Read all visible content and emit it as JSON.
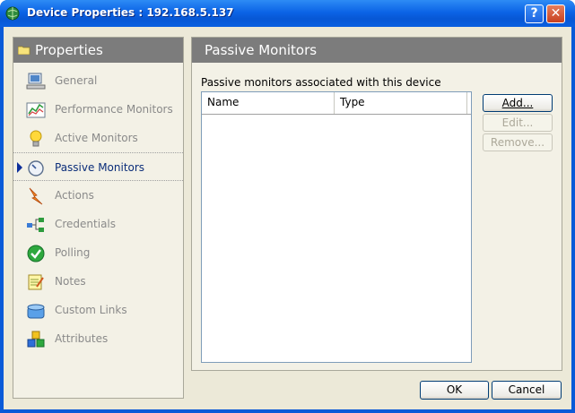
{
  "window": {
    "title": "Device Properties : 192.168.5.137",
    "help_label": "?",
    "close_label": "✕"
  },
  "sidebar": {
    "title": "Properties",
    "items": [
      {
        "label": "General",
        "icon": "computer-icon",
        "selected": false
      },
      {
        "label": "Performance Monitors",
        "icon": "performance-chart-icon",
        "selected": false
      },
      {
        "label": "Active Monitors",
        "icon": "lightbulb-icon",
        "selected": false
      },
      {
        "label": "Passive Monitors",
        "icon": "gauge-icon",
        "selected": true
      },
      {
        "label": "Actions",
        "icon": "lightning-icon",
        "selected": false
      },
      {
        "label": "Credentials",
        "icon": "network-icon",
        "selected": false
      },
      {
        "label": "Polling",
        "icon": "checkmark-icon",
        "selected": false
      },
      {
        "label": "Notes",
        "icon": "notepad-icon",
        "selected": false
      },
      {
        "label": "Custom Links",
        "icon": "links-icon",
        "selected": false
      },
      {
        "label": "Attributes",
        "icon": "blocks-icon",
        "selected": false
      }
    ]
  },
  "panel": {
    "title": "Passive Monitors",
    "list_label": "Passive monitors associated with this device",
    "columns": [
      "Name",
      "Type"
    ],
    "rows": [],
    "buttons": {
      "add": {
        "label": "Add...",
        "enabled": true
      },
      "edit": {
        "label": "Edit...",
        "enabled": false
      },
      "remove": {
        "label": "Remove...",
        "enabled": false
      }
    }
  },
  "footer": {
    "ok_label": "OK",
    "cancel_label": "Cancel"
  },
  "colors": {
    "title_bar": "#0A5AD8",
    "header_gray": "#7C7C7C",
    "dialog_bg": "#ECE9D8",
    "selected_text": "#0C2E7A"
  }
}
